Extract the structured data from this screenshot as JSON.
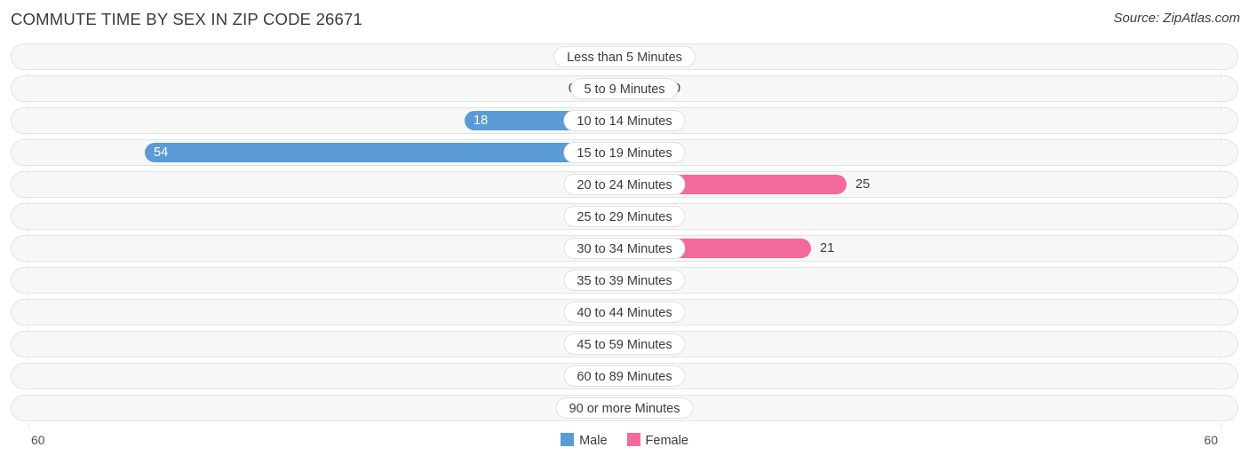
{
  "header": {
    "title": "COMMUTE TIME BY SEX IN ZIP CODE 26671",
    "source": "Source: ZipAtlas.com"
  },
  "legend": {
    "male_label": "Male",
    "female_label": "Female",
    "male_color": "#5b9bd5",
    "female_color": "#f4699b"
  },
  "axis": {
    "left_end": "60",
    "right_end": "60"
  },
  "chart_data": {
    "type": "bar",
    "subtype": "diverging-horizontal",
    "title": "COMMUTE TIME BY SEX IN ZIP CODE 26671",
    "xlabel": "",
    "ylabel": "",
    "xlim": [
      60,
      60
    ],
    "axis_max": 60,
    "grid": true,
    "legend_position": "bottom-center",
    "categories": [
      "Less than 5 Minutes",
      "5 to 9 Minutes",
      "10 to 14 Minutes",
      "15 to 19 Minutes",
      "20 to 24 Minutes",
      "25 to 29 Minutes",
      "30 to 34 Minutes",
      "35 to 39 Minutes",
      "40 to 44 Minutes",
      "45 to 59 Minutes",
      "60 to 89 Minutes",
      "90 or more Minutes"
    ],
    "series": [
      {
        "name": "Male",
        "direction": "left",
        "color": "#5b9bd5",
        "values": [
          0,
          0,
          18,
          54,
          0,
          0,
          0,
          0,
          0,
          0,
          0,
          0
        ],
        "labels": [
          "0",
          "0",
          "18",
          "54",
          "0",
          "0",
          "0",
          "0",
          "0",
          "0",
          "0",
          "0"
        ]
      },
      {
        "name": "Female",
        "direction": "right",
        "color": "#f4699b",
        "values": [
          0,
          0,
          0,
          0,
          25,
          0,
          21,
          0,
          0,
          0,
          0,
          0
        ],
        "labels": [
          "0",
          "0",
          "0",
          "0",
          "25",
          "0",
          "21",
          "0",
          "0",
          "0",
          "0",
          "0"
        ]
      }
    ]
  }
}
